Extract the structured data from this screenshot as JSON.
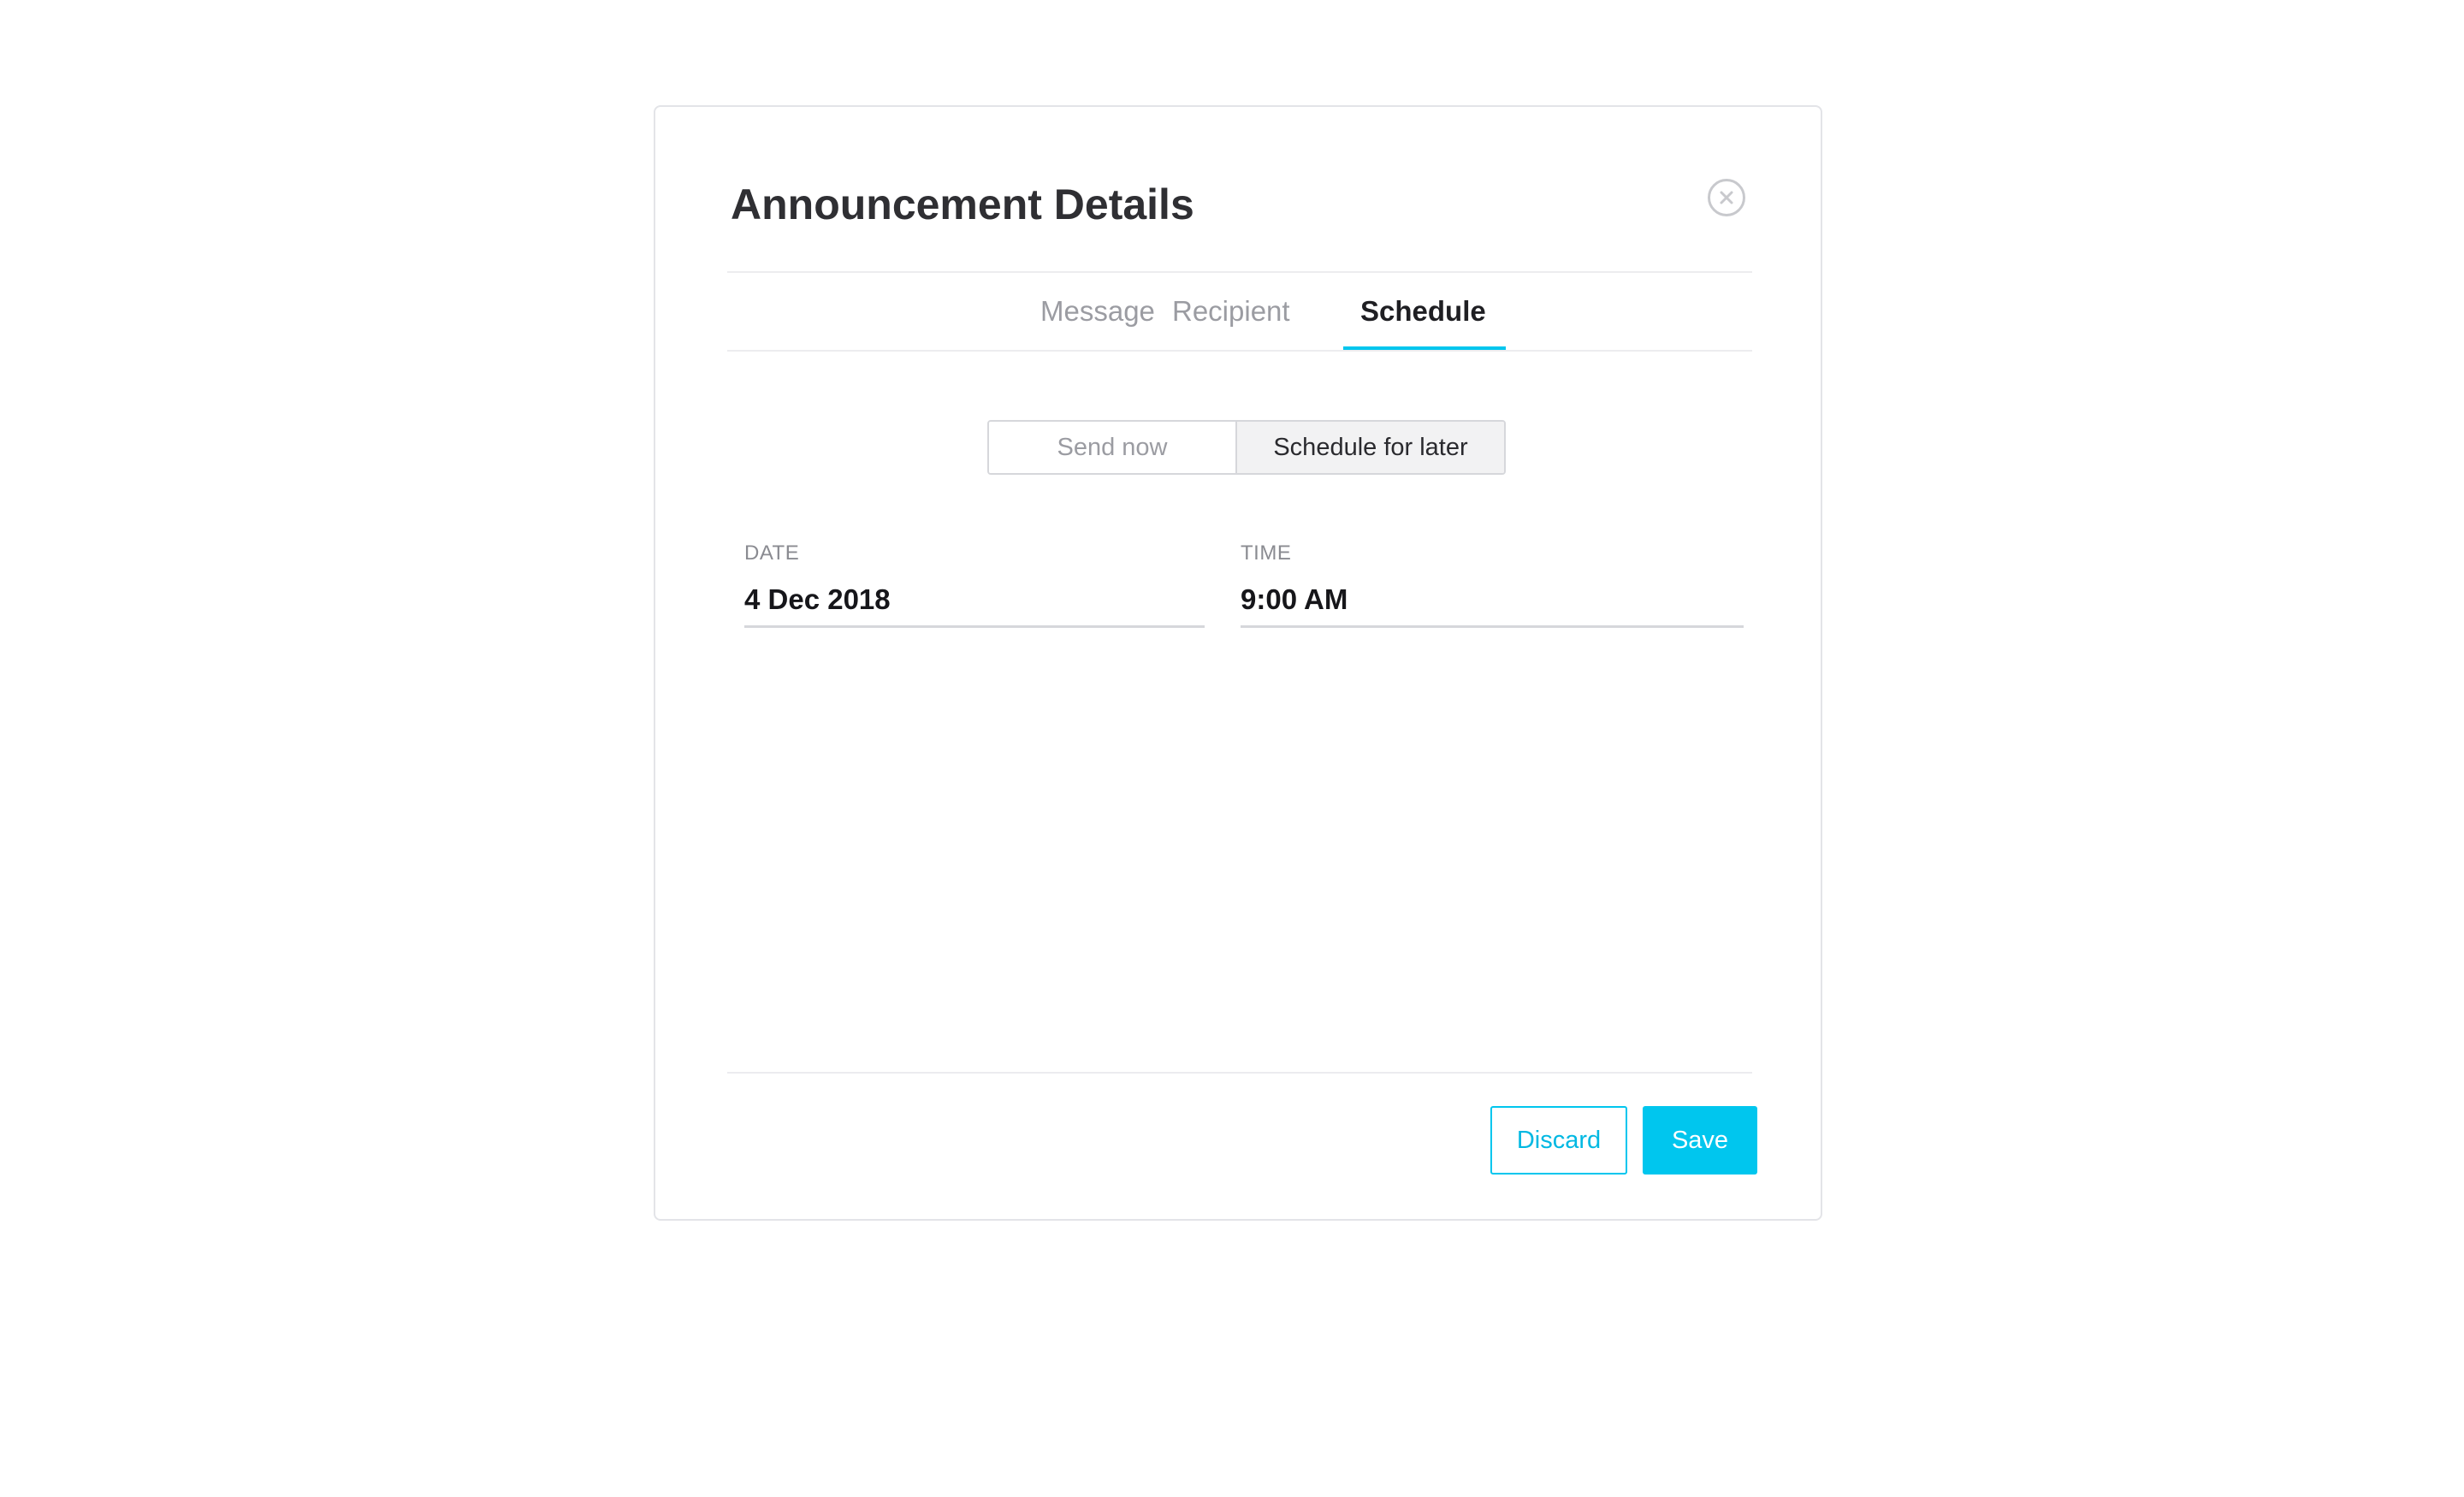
{
  "modal": {
    "title": "Announcement Details",
    "close_icon": "close-circle-icon"
  },
  "tabs": [
    {
      "label": "Message",
      "active": false
    },
    {
      "label": "Recipient",
      "active": false
    },
    {
      "label": "Schedule",
      "active": true
    }
  ],
  "send_mode": {
    "options": [
      "Send now",
      "Schedule for later"
    ],
    "selected": "Schedule for later"
  },
  "date_field": {
    "label": "DATE",
    "value": "4 Dec 2018"
  },
  "time_field": {
    "label": "TIME",
    "value": "9:00 AM"
  },
  "footer": {
    "discard_label": "Discard",
    "save_label": "Save"
  },
  "colors": {
    "accent": "#00c6ee",
    "title": "#2f2f33",
    "muted": "#9b9ca2",
    "border": "#e3e4e8"
  }
}
